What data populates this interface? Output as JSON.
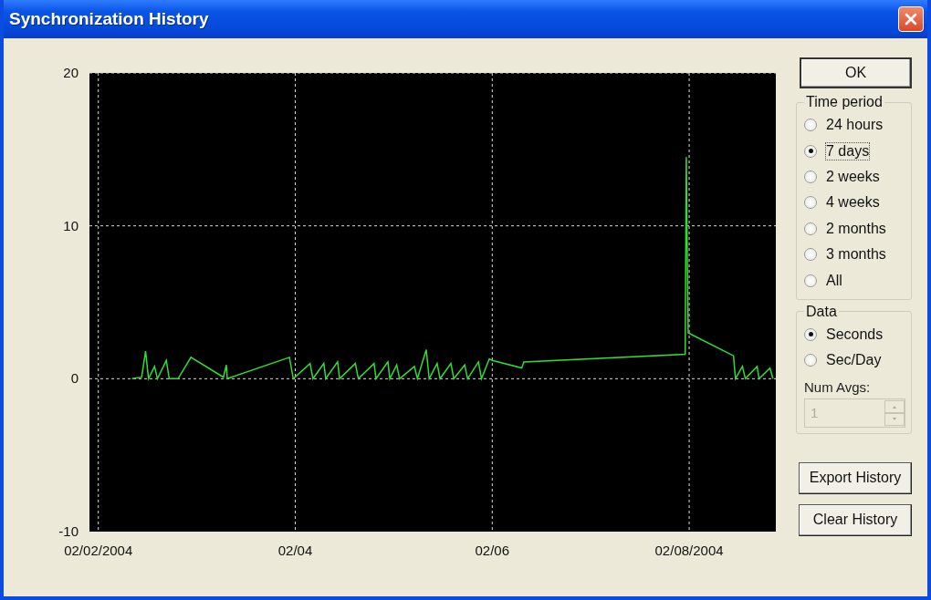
{
  "window": {
    "title": "Synchronization History"
  },
  "chart": {
    "chart_data": {
      "type": "line",
      "x": [
        "2004-02-02T08:10",
        "2004-02-02T10:34",
        "2004-02-02T11:31",
        "2004-02-02T12:14",
        "2004-02-02T13:41",
        "2004-02-02T14:24",
        "2004-02-02T16:34",
        "2004-02-02T17:17",
        "2004-02-02T19:26",
        "2004-02-02T22:34",
        "2004-02-03T06:29",
        "2004-02-03T07:12",
        "2004-02-03T07:26",
        "2004-02-03T22:34",
        "2004-02-03T23:31",
        "2004-02-04T03:36",
        "2004-02-04T04:19",
        "2004-02-04T06:58",
        "2004-02-04T07:26",
        "2004-02-04T10:19",
        "2004-02-04T10:48",
        "2004-02-04T14:38",
        "2004-02-04T15:22",
        "2004-02-04T19:12",
        "2004-02-04T19:41",
        "2004-02-04T22:34",
        "2004-02-04T23:02",
        "2004-02-05T00:43",
        "2004-02-05T01:26",
        "2004-02-05T05:02",
        "2004-02-05T05:46",
        "2004-02-05T07:55",
        "2004-02-05T08:38",
        "2004-02-05T10:34",
        "2004-02-05T11:17",
        "2004-02-05T13:55",
        "2004-02-05T14:38",
        "2004-02-05T17:17",
        "2004-02-05T18:00",
        "2004-02-05T20:38",
        "2004-02-05T21:22",
        "2004-02-05T23:17",
        "2004-02-06T00:00",
        "2004-02-06T07:12",
        "2004-02-06T07:41",
        "2004-02-07T23:02",
        "2004-02-07T23:17",
        "2004-02-07T23:31",
        "2004-02-07T23:46",
        "2004-02-08T10:48",
        "2004-02-08T11:17",
        "2004-02-08T12:58",
        "2004-02-08T13:41",
        "2004-02-08T16:34",
        "2004-02-08T17:02",
        "2004-02-08T19:41",
        "2004-02-08T20:24"
      ],
      "series": [
        {
          "color": "#33dd33",
          "values": [
            0,
            0.1,
            1.8,
            0,
            0.8,
            0,
            1.2,
            0,
            0,
            1.4,
            0.1,
            0.9,
            0,
            1.4,
            0,
            1.0,
            0,
            1.0,
            0,
            1.1,
            0,
            1.0,
            0,
            1.0,
            0,
            1.1,
            0,
            0.9,
            0,
            0.8,
            0,
            1.9,
            0,
            1.0,
            0,
            1.0,
            0,
            0.9,
            0,
            1.1,
            0,
            1.3,
            1.2,
            0.7,
            1.1,
            1.6,
            14.5,
            8.5,
            3.0,
            1.5,
            0,
            0.8,
            0,
            0.8,
            0,
            0.7,
            0
          ]
        }
      ],
      "xlim": [
        "2004-02-01T21:50",
        "2004-02-08T21:07"
      ],
      "ylim": [
        -10,
        20
      ],
      "xticks": [
        {
          "value": "2004-02-02",
          "label": "02/02/2004"
        },
        {
          "value": "2004-02-04",
          "label": "02/04"
        },
        {
          "value": "2004-02-06",
          "label": "02/06"
        },
        {
          "value": "2004-02-08",
          "label": "02/08/2004"
        }
      ],
      "yticks": [
        -10,
        0,
        10,
        20
      ],
      "grid": true
    }
  },
  "ok_button": "OK",
  "time_period": {
    "label": "Time period",
    "options": [
      {
        "label": "24 hours",
        "selected": false
      },
      {
        "label": "7 days",
        "selected": true
      },
      {
        "label": "2 weeks",
        "selected": false
      },
      {
        "label": "4 weeks",
        "selected": false
      },
      {
        "label": "2 months",
        "selected": false
      },
      {
        "label": "3 months",
        "selected": false
      },
      {
        "label": "All",
        "selected": false
      }
    ]
  },
  "data": {
    "label": "Data",
    "options": [
      {
        "label": "Seconds",
        "selected": true
      },
      {
        "label": "Sec/Day",
        "selected": false
      }
    ],
    "num_avgs": {
      "label": "Num Avgs:",
      "value": "1",
      "disabled": true
    }
  },
  "buttons": [
    "Export History",
    "Clear History"
  ]
}
